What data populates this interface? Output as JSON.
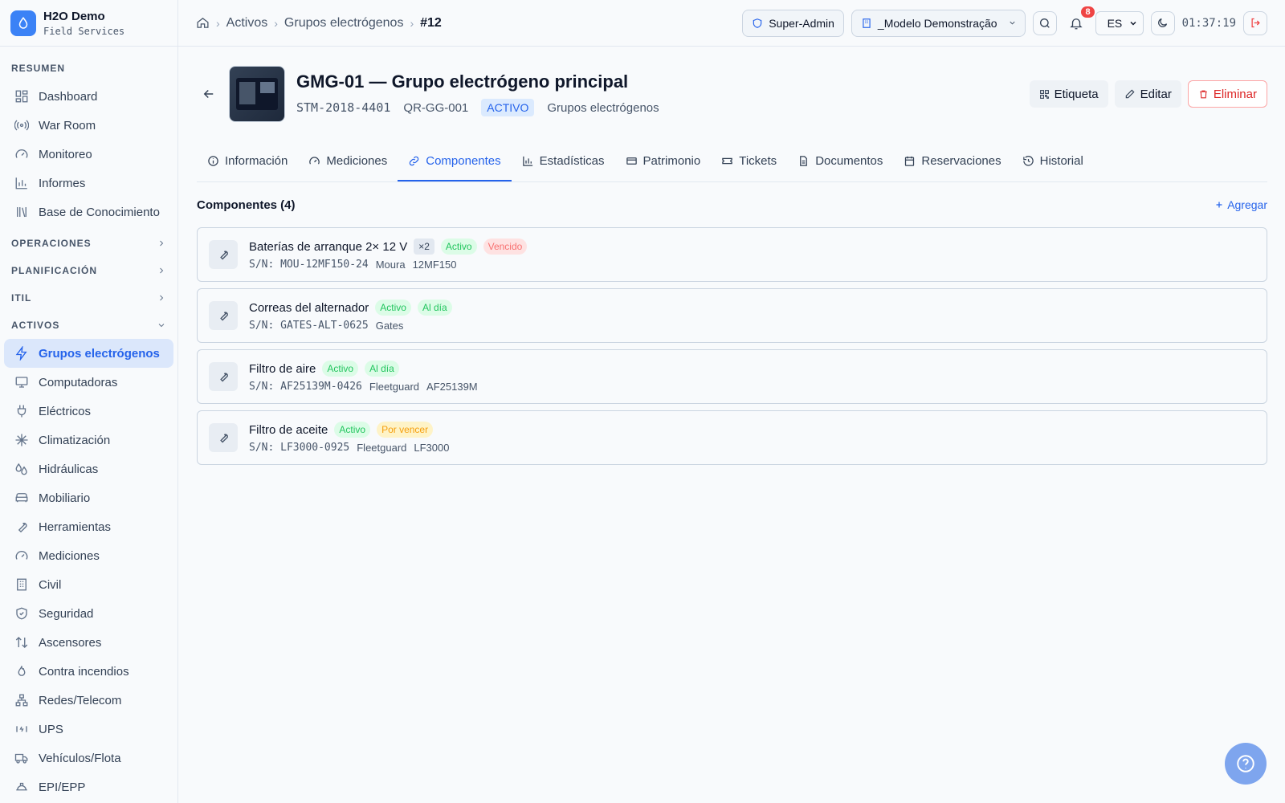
{
  "brand": {
    "name": "H2O Demo",
    "subtitle": "Field Services"
  },
  "sidebar": {
    "sections": {
      "resumen": "RESUMEN",
      "operaciones": "OPERACIONES",
      "planificacion": "PLANIFICACIÓN",
      "itil": "ITIL",
      "activos": "ACTIVOS"
    },
    "resumen_items": [
      {
        "label": "Dashboard",
        "icon": "dashboard-icon"
      },
      {
        "label": "War Room",
        "icon": "broadcast-icon"
      },
      {
        "label": "Monitoreo",
        "icon": "gauge-icon"
      },
      {
        "label": "Informes",
        "icon": "bar-chart-icon"
      },
      {
        "label": "Base de Conocimiento",
        "icon": "library-icon"
      }
    ],
    "activos_items": [
      {
        "label": "Grupos electrógenos",
        "icon": "zap-icon",
        "active": true
      },
      {
        "label": "Computadoras",
        "icon": "monitor-icon"
      },
      {
        "label": "Eléctricos",
        "icon": "plug-icon"
      },
      {
        "label": "Climatización",
        "icon": "snowflake-icon"
      },
      {
        "label": "Hidráulicas",
        "icon": "droplets-icon"
      },
      {
        "label": "Mobiliario",
        "icon": "sofa-icon"
      },
      {
        "label": "Herramientas",
        "icon": "wrench-icon"
      },
      {
        "label": "Mediciones",
        "icon": "gauge-icon"
      },
      {
        "label": "Civil",
        "icon": "building-icon"
      },
      {
        "label": "Seguridad",
        "icon": "shield-icon"
      },
      {
        "label": "Ascensores",
        "icon": "arrows-up-down-icon"
      },
      {
        "label": "Contra incendios",
        "icon": "flame-icon"
      },
      {
        "label": "Redes/Telecom",
        "icon": "network-icon"
      },
      {
        "label": "UPS",
        "icon": "battery-icon"
      },
      {
        "label": "Vehículos/Flota",
        "icon": "truck-icon"
      },
      {
        "label": "EPI/EPP",
        "icon": "hard-hat-icon"
      }
    ]
  },
  "header": {
    "breadcrumb": [
      "Activos",
      "Grupos electrógenos",
      "#12"
    ],
    "role": "Super-Admin",
    "tenant": "_Modelo Demonstração",
    "notifications": "8",
    "language": "ES",
    "clock": "01:37:19"
  },
  "asset": {
    "title": "GMG-01 — Grupo electrógeno principal",
    "serial": "STM-2018-4401",
    "qr": "QR-GG-001",
    "status": "ACTIVO",
    "category": "Grupos electrógenos",
    "actions": {
      "label": "Etiqueta",
      "edit": "Editar",
      "delete": "Eliminar"
    }
  },
  "tabs": [
    {
      "label": "Información",
      "icon": "info-icon"
    },
    {
      "label": "Mediciones",
      "icon": "gauge-icon"
    },
    {
      "label": "Componentes",
      "icon": "link-icon",
      "active": true
    },
    {
      "label": "Estadísticas",
      "icon": "bar-chart-icon"
    },
    {
      "label": "Patrimonio",
      "icon": "credit-card-icon"
    },
    {
      "label": "Tickets",
      "icon": "ticket-icon"
    },
    {
      "label": "Documentos",
      "icon": "file-icon"
    },
    {
      "label": "Reservaciones",
      "icon": "calendar-icon"
    },
    {
      "label": "Historial",
      "icon": "history-icon"
    }
  ],
  "components": {
    "title": "Componentes (4)",
    "add_label": "Agregar",
    "items": [
      {
        "name": "Baterías de arranque 2× 12 V",
        "qty": "×2",
        "status": "Activo",
        "due": "Vencido",
        "due_kind": "bad",
        "serial": "S/N: MOU-12MF150-24",
        "brand": "Moura",
        "model": "12MF150"
      },
      {
        "name": "Correas del alternador",
        "qty": null,
        "status": "Activo",
        "due": "Al día",
        "due_kind": "ok",
        "serial": "S/N: GATES-ALT-0625",
        "brand": "Gates",
        "model": ""
      },
      {
        "name": "Filtro de aire",
        "qty": null,
        "status": "Activo",
        "due": "Al día",
        "due_kind": "ok",
        "serial": "S/N: AF25139M-0426",
        "brand": "Fleetguard",
        "model": "AF25139M"
      },
      {
        "name": "Filtro de aceite",
        "qty": null,
        "status": "Activo",
        "due": "Por vencer",
        "due_kind": "warn",
        "serial": "S/N: LF3000-0925",
        "brand": "Fleetguard",
        "model": "LF3000"
      }
    ]
  }
}
